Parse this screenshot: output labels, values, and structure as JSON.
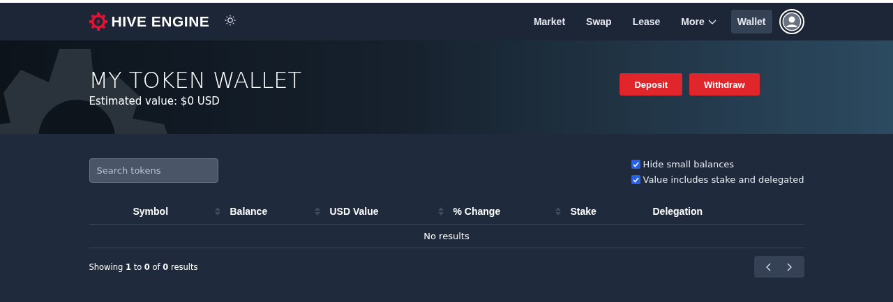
{
  "brand": {
    "name": "HIVE ENGINE"
  },
  "nav": [
    {
      "label": "Market",
      "selected": false,
      "dropdown": false
    },
    {
      "label": "Swap",
      "selected": false,
      "dropdown": false
    },
    {
      "label": "Lease",
      "selected": false,
      "dropdown": false
    },
    {
      "label": "More",
      "selected": false,
      "dropdown": true
    },
    {
      "label": "Wallet",
      "selected": true,
      "dropdown": false
    }
  ],
  "banner": {
    "title": "MY TOKEN WALLET",
    "subtitle": "Estimated value: $0 USD",
    "buttons": [
      "Deposit",
      "Withdraw"
    ]
  },
  "search": {
    "placeholder": "Search tokens"
  },
  "options": [
    {
      "label": "Hide small balances",
      "checked": true
    },
    {
      "label": "Value includes stake and delegated",
      "checked": true
    }
  ],
  "table": {
    "columns": [
      {
        "label": "Symbol",
        "sortable": true
      },
      {
        "label": "Balance",
        "sortable": true
      },
      {
        "label": "USD Value",
        "sortable": true
      },
      {
        "label": "% Change",
        "sortable": true
      },
      {
        "label": "Stake",
        "sortable": false
      },
      {
        "label": "Delegation",
        "sortable": false
      }
    ],
    "empty": "No results"
  },
  "footer": {
    "summary": "Showing **1** to **0** of **0** results"
  }
}
